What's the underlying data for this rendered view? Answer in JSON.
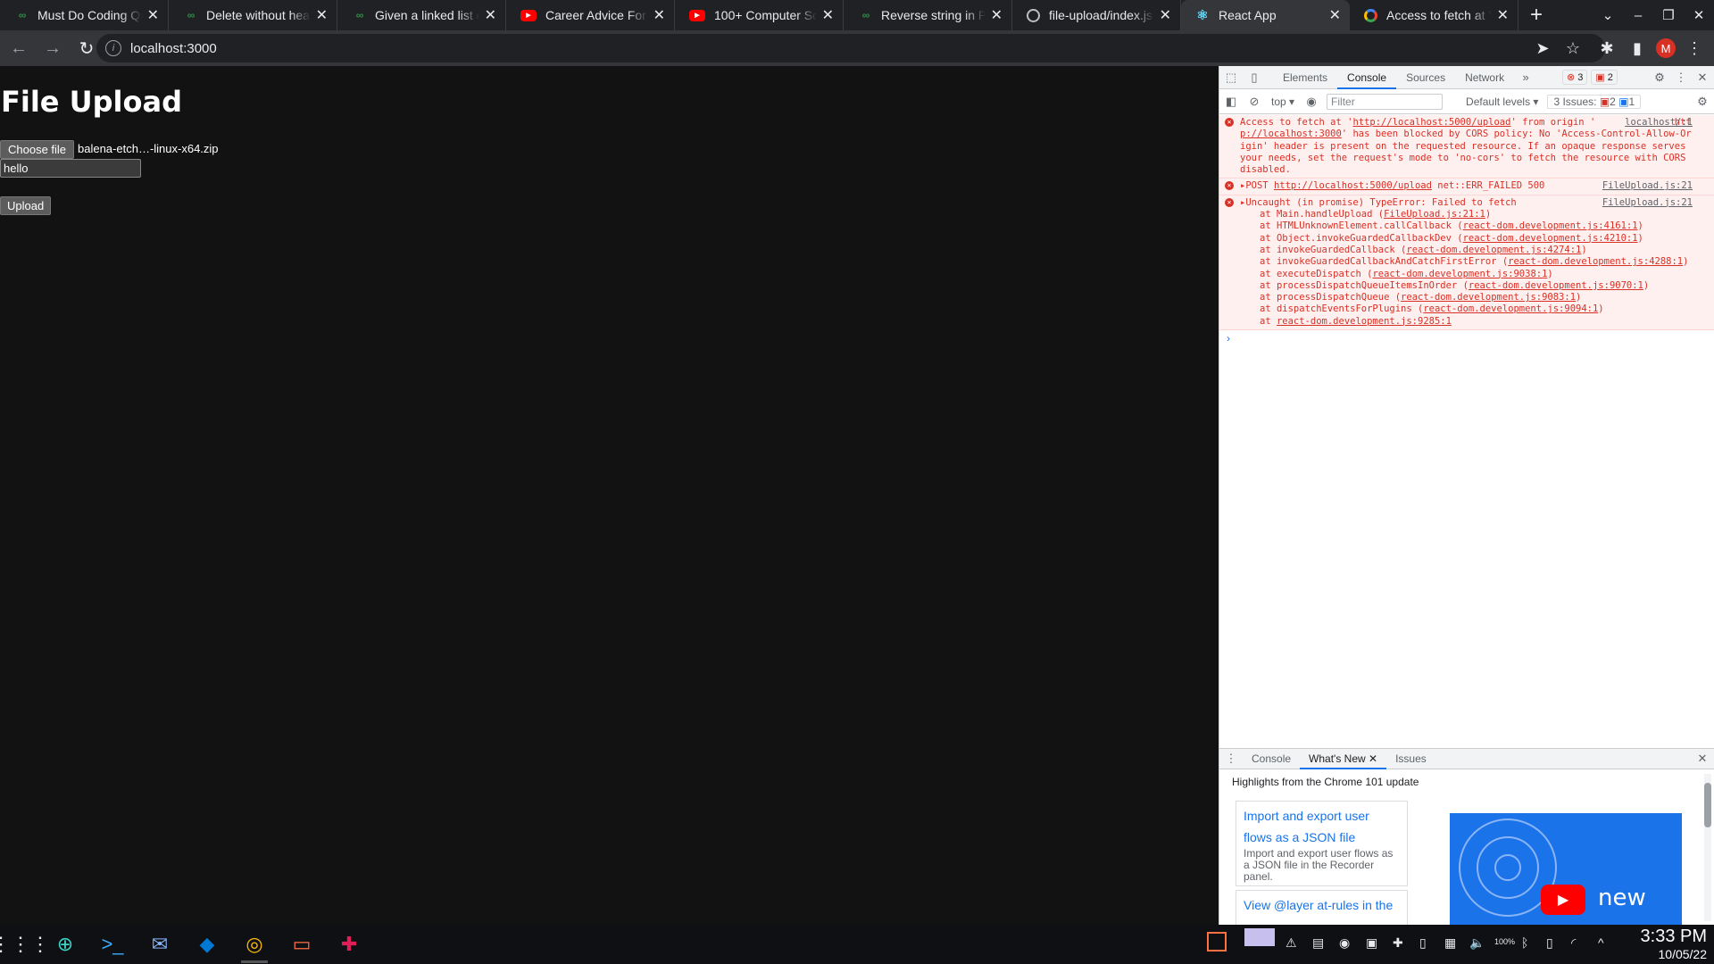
{
  "browser": {
    "tabs": [
      {
        "title": "Must Do Coding Qu",
        "favicon": "gfg-icon"
      },
      {
        "title": "Delete without head",
        "favicon": "gfg-icon"
      },
      {
        "title": "Given a linked list of",
        "favicon": "gfg-icon"
      },
      {
        "title": "Career Advice For Yo",
        "favicon": "youtube-icon"
      },
      {
        "title": "100+ Computer Scie",
        "favicon": "youtube-icon"
      },
      {
        "title": "Reverse string in Pyt",
        "favicon": "gfg-icon"
      },
      {
        "title": "file-upload/index.js a",
        "favicon": "github-icon"
      },
      {
        "title": "React App",
        "favicon": "react-icon"
      },
      {
        "title": "Access to fetch at 'ht",
        "favicon": "google-icon"
      }
    ],
    "active_tab": 7,
    "url": "localhost:3000",
    "profile_initial": "M"
  },
  "page": {
    "title": "File Upload",
    "choose_file_label": "Choose file",
    "file_name": "balena-etch…-linux-x64.zip",
    "text_value": "hello",
    "upload_label": "Upload"
  },
  "devtools": {
    "tabs": [
      "Elements",
      "Console",
      "Sources",
      "Network"
    ],
    "active_tab": "Console",
    "error_count": "3",
    "issue_count": "2",
    "context": "top",
    "filter_placeholder": "Filter",
    "levels": "Default levels",
    "issues_label": "3 Issues:",
    "issues_errors": "2",
    "issues_info": "1",
    "messages": [
      {
        "source": "localhost/:1",
        "text_1": "Access to fetch at '",
        "link_1": "http://localhost:5000/upload",
        "text_2": "' from origin '",
        "link_2": "http://localhost:3000",
        "text_3": "' has been blocked by CORS policy: No 'Access-Control-Allow-Origin' header is present on the requested resource. If an opaque response serves your needs, set the request's mode to 'no-cors' to fetch the resource with CORS disabled."
      },
      {
        "source": "FileUpload.js:21",
        "prefix": "▸POST ",
        "link": "http://localhost:5000/upload",
        "suffix": " net::ERR_FAILED 500"
      },
      {
        "source": "FileUpload.js:21",
        "headline": "▸Uncaught (in promise) TypeError: Failed to fetch",
        "stack": [
          {
            "fn": "at Main.handleUpload (",
            "loc": "FileUpload.js:21:1",
            "end": ")"
          },
          {
            "fn": "at HTMLUnknownElement.callCallback (",
            "loc": "react-dom.development.js:4161:1",
            "end": ")"
          },
          {
            "fn": "at Object.invokeGuardedCallbackDev (",
            "loc": "react-dom.development.js:4210:1",
            "end": ")"
          },
          {
            "fn": "at invokeGuardedCallback (",
            "loc": "react-dom.development.js:4274:1",
            "end": ")"
          },
          {
            "fn": "at invokeGuardedCallbackAndCatchFirstError (",
            "loc": "react-dom.development.js:4288:1",
            "end": ")"
          },
          {
            "fn": "at executeDispatch (",
            "loc": "react-dom.development.js:9038:1",
            "end": ")"
          },
          {
            "fn": "at processDispatchQueueItemsInOrder (",
            "loc": "react-dom.development.js:9070:1",
            "end": ")"
          },
          {
            "fn": "at processDispatchQueue (",
            "loc": "react-dom.development.js:9083:1",
            "end": ")"
          },
          {
            "fn": "at dispatchEventsForPlugins (",
            "loc": "react-dom.development.js:9094:1",
            "end": ")"
          },
          {
            "fn": "at ",
            "loc": "react-dom.development.js:9285:1",
            "end": ""
          }
        ]
      }
    ],
    "drawer": {
      "tabs": [
        "Console",
        "What's New",
        "Issues"
      ],
      "active_tab": "What's New",
      "highlights": "Highlights from the Chrome 101 update",
      "card1_title": "Import and export user flows as a JSON file",
      "card1_desc": "Import and export user flows as a JSON file in the Recorder panel.",
      "card2_title": "View @layer at-rules in the",
      "video_text": "new"
    }
  },
  "taskbar": {
    "time": "3:33 PM",
    "date": "10/05/22",
    "battery": "100%"
  },
  "colors": {
    "page_bg": "#121212",
    "error": "#d93025",
    "accent": "#1a73e8"
  }
}
